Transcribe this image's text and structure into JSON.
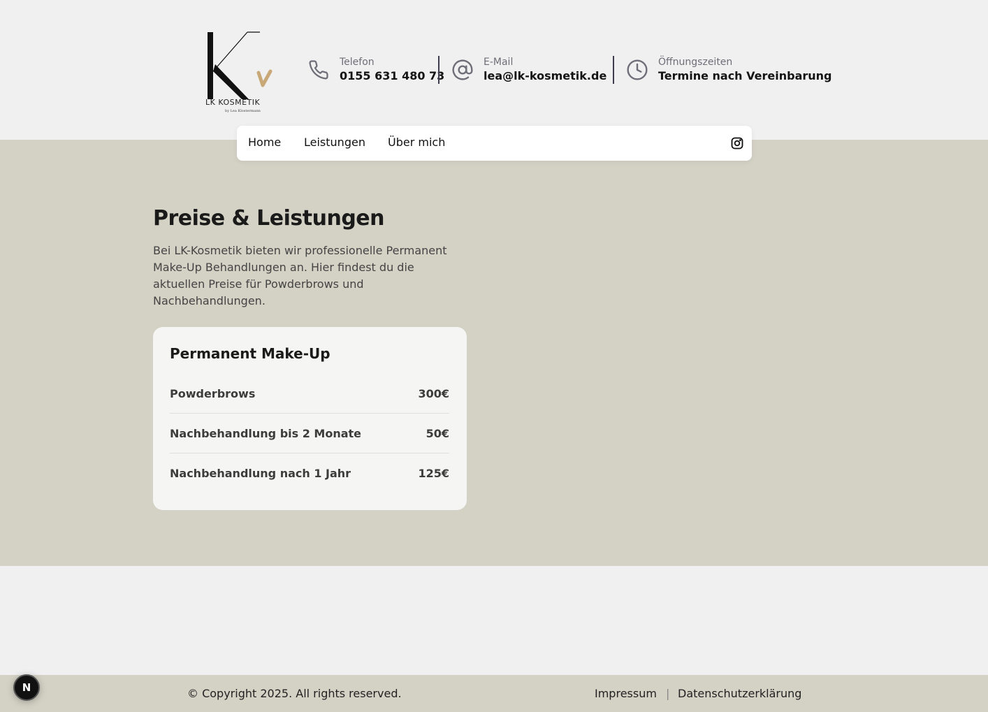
{
  "brand": {
    "logo_text": "LK KOSMETIK",
    "logo_sub": "by Lea Klostermann",
    "logo_accent_color": "#c9a878"
  },
  "contacts": [
    {
      "icon": "phone-icon",
      "label": "Telefon",
      "value": "0155 631 480 73"
    },
    {
      "icon": "at-icon",
      "label": "E-Mail",
      "value": "lea@lk-kosmetik.de"
    },
    {
      "icon": "clock-icon",
      "label": "Öffnungszeiten",
      "value": "Termine nach Vereinbarung"
    }
  ],
  "nav": {
    "items": [
      "Home",
      "Leistungen",
      "Über mich"
    ],
    "social_icon": "instagram-icon"
  },
  "main": {
    "title": "Preise & Leistungen",
    "intro": "Bei LK-Kosmetik bieten wir professionelle Permanent Make-Up Behandlungen an. Hier findest du die aktuellen Preise für Powderbrows und Nachbehandlungen.",
    "card": {
      "title": "Permanent Make-Up",
      "items": [
        {
          "name": "Powderbrows",
          "price": "300€"
        },
        {
          "name": "Nachbehandlung bis 2 Monate",
          "price": "50€"
        },
        {
          "name": "Nachbehandlung nach 1 Jahr",
          "price": "125€"
        }
      ]
    }
  },
  "footer": {
    "copyright": "© Copyright 2025. All rights reserved.",
    "links": [
      "Impressum",
      "Datenschutzerklärung"
    ],
    "separator": "|"
  },
  "dev_badge": {
    "label": "N"
  },
  "colors": {
    "page_bg": "#f0f0f0",
    "section_bg": "#d4d1c5",
    "card_bg": "#f5f5f3",
    "icon_color": "#6e6e78"
  }
}
